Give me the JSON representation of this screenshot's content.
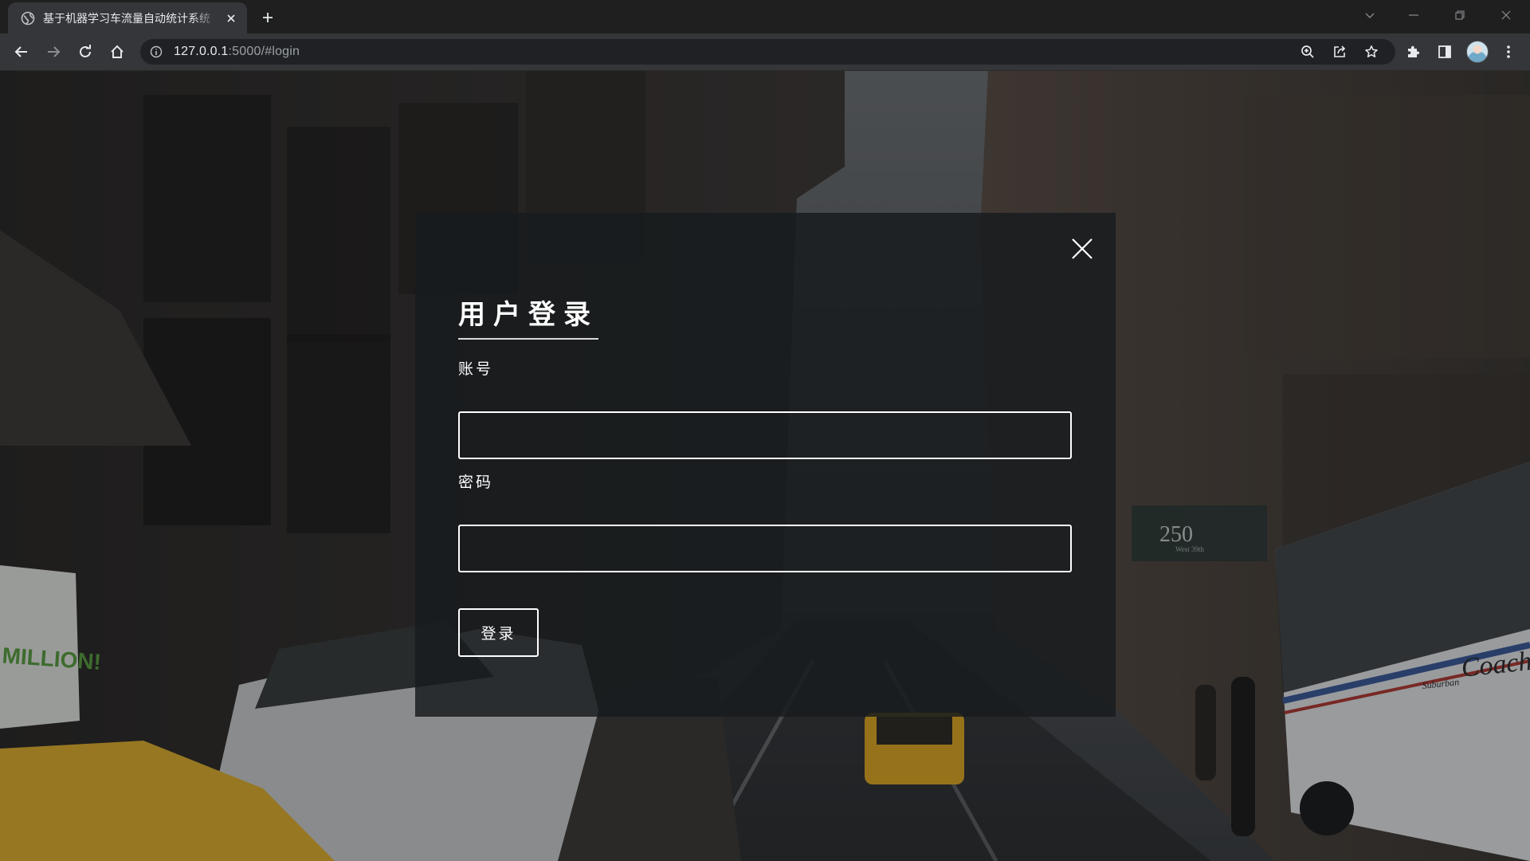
{
  "browser": {
    "tab_title": "基于机器学习车流量自动统计系统",
    "url_host": "127.0.0.1",
    "url_rest": ":5000/#login",
    "icons": [
      "globe-icon",
      "close-icon",
      "plus-icon",
      "back-icon",
      "forward-icon",
      "reload-icon",
      "home-icon",
      "info-icon",
      "zoom-icon",
      "share-icon",
      "star-icon",
      "extensions-icon",
      "side-panel-icon",
      "avatar",
      "more-icon"
    ]
  },
  "background": {
    "sign_left": "MILLION!",
    "sign_building": "250",
    "sign_building_sub": "West 39th",
    "bus_text": "Coach US",
    "bus_small": "Suburban"
  },
  "login_modal": {
    "title": "用户登录",
    "account_label": "账号",
    "account_value": "",
    "password_label": "密码",
    "password_value": "",
    "submit_label": "登录"
  },
  "colors": {
    "modal_bg": "#181b1e",
    "text": "#ffffff",
    "chrome_dark": "#1f1f1f",
    "chrome_toolbar": "#35363a"
  }
}
